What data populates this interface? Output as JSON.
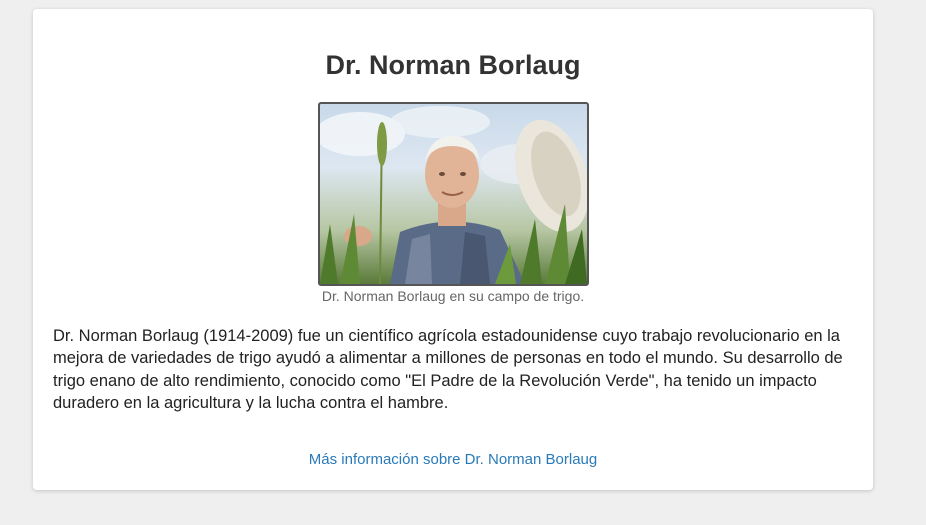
{
  "article": {
    "title": "Dr. Norman Borlaug",
    "image": {
      "icon": "portrait-photo-wheat-field",
      "caption": "Dr. Norman Borlaug en su campo de trigo."
    },
    "paragraph": "Dr. Norman Borlaug (1914-2009) fue un científico agrícola estadounidense cuyo trabajo revolucionario en la mejora de variedades de trigo ayudó a alimentar a millones de personas en todo el mundo. Su desarrollo de trigo enano de alto rendimiento, conocido como \"El Padre de la Revolución Verde\", ha tenido un impacto duradero en la agricultura y la lucha contra el hambre.",
    "link_label": "Más información sobre Dr. Norman Borlaug"
  },
  "colors": {
    "page_background": "#efefef",
    "card_background": "#ffffff",
    "title": "#333333",
    "link": "#2a7ab8"
  }
}
